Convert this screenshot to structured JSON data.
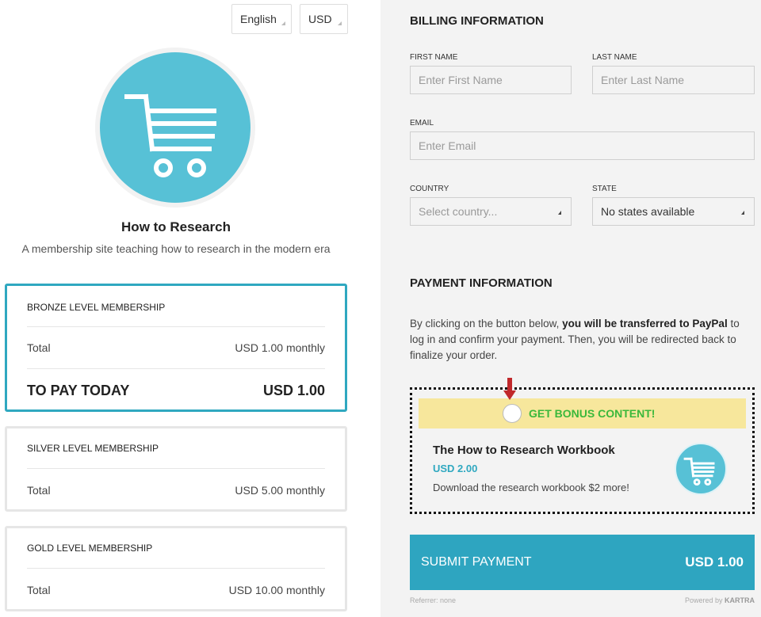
{
  "header": {
    "language": "English",
    "currency": "USD"
  },
  "product": {
    "title": "How to Research",
    "description": "A membership site teaching how to research in the modern era",
    "logo_icon": "shopping-cart-icon",
    "accent_color": "#57c1d6"
  },
  "plans": [
    {
      "name": "BRONZE LEVEL MEMBERSHIP",
      "total_label": "Total",
      "total_value": "USD 1.00 monthly",
      "pay_today_label": "TO PAY TODAY",
      "pay_today_value": "USD 1.00",
      "selected": true
    },
    {
      "name": "SILVER LEVEL MEMBERSHIP",
      "total_label": "Total",
      "total_value": "USD 5.00 monthly",
      "selected": false
    },
    {
      "name": "GOLD LEVEL MEMBERSHIP",
      "total_label": "Total",
      "total_value": "USD 10.00 monthly",
      "selected": false
    }
  ],
  "billing": {
    "heading": "BILLING INFORMATION",
    "first_name_label": "FIRST NAME",
    "first_name_placeholder": "Enter First Name",
    "last_name_label": "LAST NAME",
    "last_name_placeholder": "Enter Last Name",
    "email_label": "EMAIL",
    "email_placeholder": "Enter Email",
    "country_label": "COUNTRY",
    "country_value": "Select country...",
    "state_label": "STATE",
    "state_value": "No states available"
  },
  "payment": {
    "heading": "PAYMENT INFORMATION",
    "text_before": "By clicking on the button below, ",
    "text_bold": "you will be transferred to PayPal",
    "text_after": " to log in and confirm your payment. Then, you will be redirected back to finalize your order."
  },
  "bonus": {
    "cta": "GET BONUS CONTENT!",
    "title": "The How to Research Workbook",
    "price": "USD 2.00",
    "description": "Download the research workbook $2 more!",
    "bar_color": "#f7e79c",
    "cta_color": "#3bb83b",
    "arrow_color": "#c0282b"
  },
  "submit": {
    "label": "SUBMIT PAYMENT",
    "amount": "USD 1.00",
    "color": "#2ea5c0"
  },
  "footer": {
    "referrer": "Referrer: none",
    "powered_prefix": "Powered by ",
    "powered_brand": "KARTRA"
  }
}
